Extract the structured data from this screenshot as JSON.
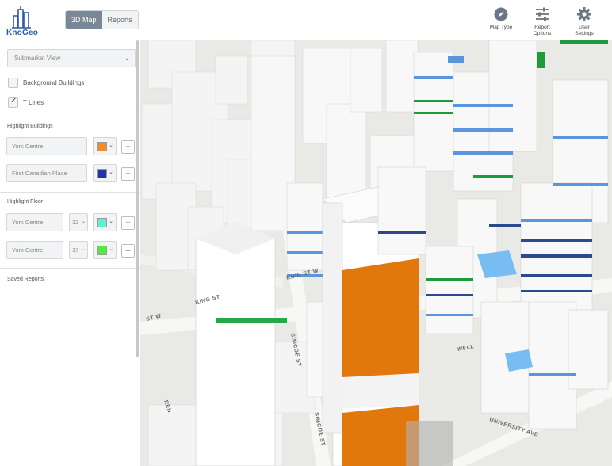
{
  "app": {
    "logo_text": "KnoGeo"
  },
  "header": {
    "tabs": [
      {
        "label": "3D Map",
        "active": true
      },
      {
        "label": "Reports",
        "active": false
      }
    ],
    "tools": [
      {
        "label": "Map Type",
        "icon": "compass-icon"
      },
      {
        "label": "Report Options",
        "icon": "sliders-icon"
      },
      {
        "label": "User Settings",
        "icon": "gear-icon"
      }
    ]
  },
  "sidebar": {
    "submarket": {
      "value": "Submarket View"
    },
    "layers": [
      {
        "label": "Background Buildings",
        "checked": false
      },
      {
        "label": "T Lines",
        "checked": true
      }
    ],
    "highlight_buildings": {
      "title": "Highlight Buildings",
      "rows": [
        {
          "name": "York Centre",
          "color": "#f28c28"
        },
        {
          "name": "First Canadian Place",
          "color": "#2233a8"
        }
      ]
    },
    "highlight_floor": {
      "title": "Highlight Floor",
      "rows": [
        {
          "name": "York Centre",
          "floor": "12",
          "color": "#5ff0d8"
        },
        {
          "name": "York Centre",
          "floor": "17",
          "color": "#4cf03a"
        }
      ]
    },
    "saved_reports": {
      "title": "Saved Reports"
    },
    "buttons": {
      "minus": "−",
      "plus": "+"
    }
  },
  "map": {
    "street_labels": [
      "KING ST W",
      "KING ST",
      "SIMCOE ST",
      "SIMCOE ST",
      "UNIVERSITY AVE",
      "WELL",
      "ST W",
      "REN"
    ],
    "colors": {
      "highlight_building": "#e2780c",
      "floor_highlight_a": "#5a95de",
      "floor_highlight_b": "#1f9a3a",
      "floor_highlight_c": "#2b4a8c",
      "selected_roof": "#78bdf2"
    }
  }
}
